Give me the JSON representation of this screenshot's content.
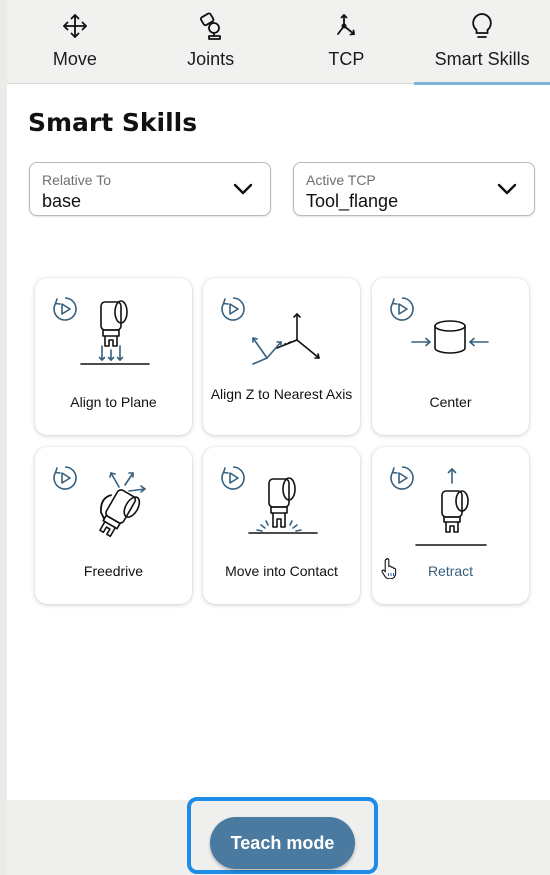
{
  "tabs": [
    {
      "label": "Move",
      "icon": "move-arrows-icon"
    },
    {
      "label": "Joints",
      "icon": "robot-joint-icon"
    },
    {
      "label": "TCP",
      "icon": "tcp-axes-icon"
    },
    {
      "label": "Smart Skills",
      "icon": "lightbulb-icon",
      "active": true
    }
  ],
  "page": {
    "title": "Smart Skills"
  },
  "relative_to": {
    "label": "Relative To",
    "value": "base"
  },
  "active_tcp": {
    "label": "Active TCP",
    "value": "Tool_flange"
  },
  "skills": [
    {
      "label": "Align to Plane"
    },
    {
      "label": "Align Z to Nearest Axis"
    },
    {
      "label": "Center"
    },
    {
      "label": "Freedrive"
    },
    {
      "label": "Move into Contact"
    },
    {
      "label": "Retract"
    }
  ],
  "footer": {
    "teach_mode_label": "Teach mode"
  },
  "colors": {
    "accent": "#4a7aa0",
    "icon_stroke": "#2d5e80",
    "focus_ring": "#1e8ce6",
    "tab_indicator": "#7db3d9"
  }
}
